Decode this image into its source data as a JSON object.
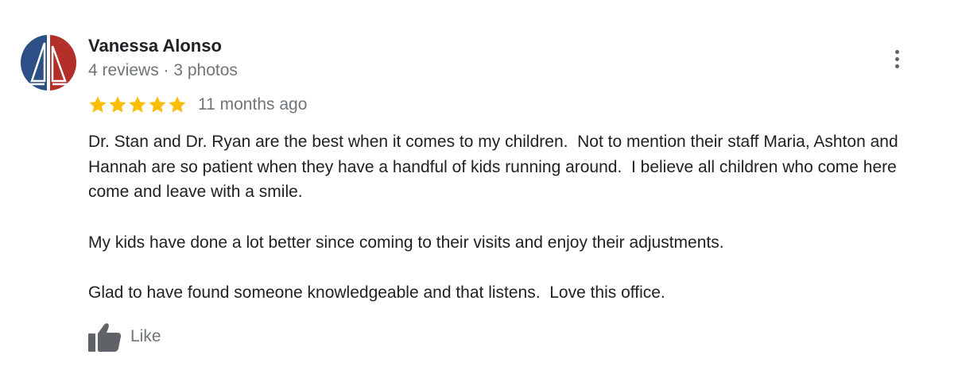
{
  "reviewer": {
    "name": "Vanessa Alonso",
    "meta": "4 reviews · 3 photos",
    "avatar_colors": [
      "#2c4f86",
      "#b22f2a",
      "#ffffff"
    ]
  },
  "rating": {
    "stars": 5,
    "max": 5,
    "star_color": "#fbbc04",
    "time_ago": "11 months ago"
  },
  "review": {
    "paragraphs": [
      "Dr. Stan and Dr. Ryan are the best when it comes to my children.  Not to mention their staff Maria, Ashton and Hannah are so patient when they have a handful of kids running around.  I believe all children who come here come and leave with a smile.",
      "My kids have done a lot better since coming to their visits and enjoy their adjustments.",
      "Glad to have found someone knowledgeable and that listens.  Love this office."
    ]
  },
  "actions": {
    "like_label": "Like",
    "like_icon": "thumbs-up-icon",
    "more_icon": "more-vert-icon"
  }
}
